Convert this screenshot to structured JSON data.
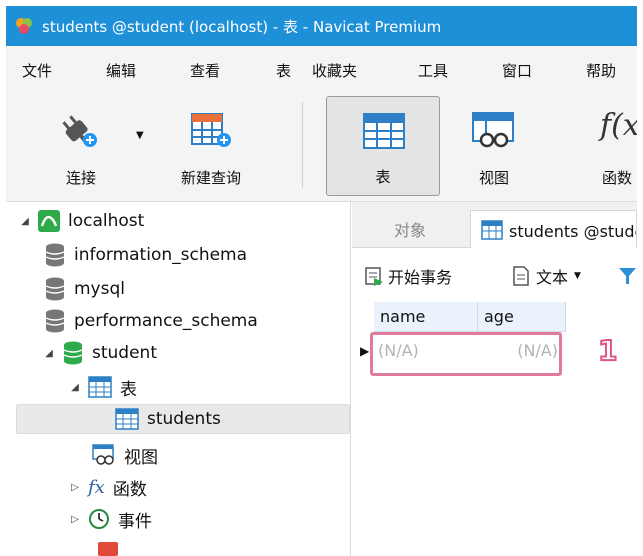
{
  "window": {
    "title": "students @student (localhost) - 表 - Navicat Premium"
  },
  "menu": [
    "文件",
    "编辑",
    "查看",
    "表",
    "收藏夹",
    "工具",
    "窗口",
    "帮助"
  ],
  "toolbar": {
    "connect": "连接",
    "new_query": "新建查询",
    "table": "表",
    "view": "视图",
    "function": "函数"
  },
  "tree": {
    "localhost": "localhost",
    "information_schema": "information_schema",
    "mysql": "mysql",
    "performance_schema": "performance_schema",
    "student": "student",
    "tables_group": "表",
    "students": "students",
    "views_group": "视图",
    "functions_group": "函数",
    "events_group": "事件"
  },
  "tabs": {
    "objects": "对象",
    "students": "students @student (localhost) - 表"
  },
  "subtoolbar": {
    "begin_transaction": "开始事务",
    "text": "文本"
  },
  "grid": {
    "columns": [
      "name",
      "age"
    ],
    "rows": [
      [
        "(N/A)",
        "(N/A)"
      ]
    ]
  },
  "annotation": {
    "marker": "1"
  },
  "colors": {
    "titlebar": "#1e90d8",
    "highlight": "#e07c99",
    "marker": "#e35582"
  }
}
